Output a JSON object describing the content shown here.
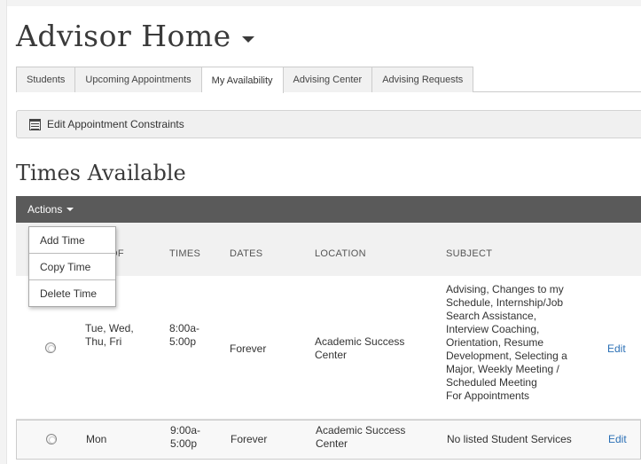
{
  "header": {
    "title": "Advisor Home"
  },
  "tabs": [
    {
      "label": "Students"
    },
    {
      "label": "Upcoming Appointments"
    },
    {
      "label": "My Availability"
    },
    {
      "label": "Advising Center"
    },
    {
      "label": "Advising Requests"
    }
  ],
  "active_tab": "My Availability",
  "constraints_button": {
    "label": "Edit Appointment Constraints"
  },
  "section": {
    "title": "Times Available"
  },
  "actions": {
    "label": "Actions",
    "menu": [
      "Add Time",
      "Copy Time",
      "Delete Time"
    ]
  },
  "columns": {
    "days_partial": "OF",
    "times": "TIMES",
    "dates": "DATES",
    "location": "LOCATION",
    "subject": "SUBJECT"
  },
  "rows": [
    {
      "days": "Tue, Wed,\nThu, Fri",
      "times": "8:00a-\n5:00p",
      "dates": "Forever",
      "location": "Academic Success\nCenter",
      "subject": "Advising, Changes to my\nSchedule, Internship/Job\nSearch Assistance,\nInterview Coaching,\nOrientation, Resume\nDevelopment, Selecting a\nMajor, Weekly Meeting /\nScheduled Meeting\nFor Appointments",
      "edit": "Edit"
    },
    {
      "days": "Mon",
      "times": "9:00a-\n5:00p",
      "dates": "Forever",
      "location": "Academic Success\nCenter",
      "subject": "No listed Student Services",
      "edit": "Edit"
    }
  ],
  "colors": {
    "action_bar": "#5a5a5a",
    "link": "#2a6fb5",
    "tab_bg": "#f1f1f1"
  }
}
